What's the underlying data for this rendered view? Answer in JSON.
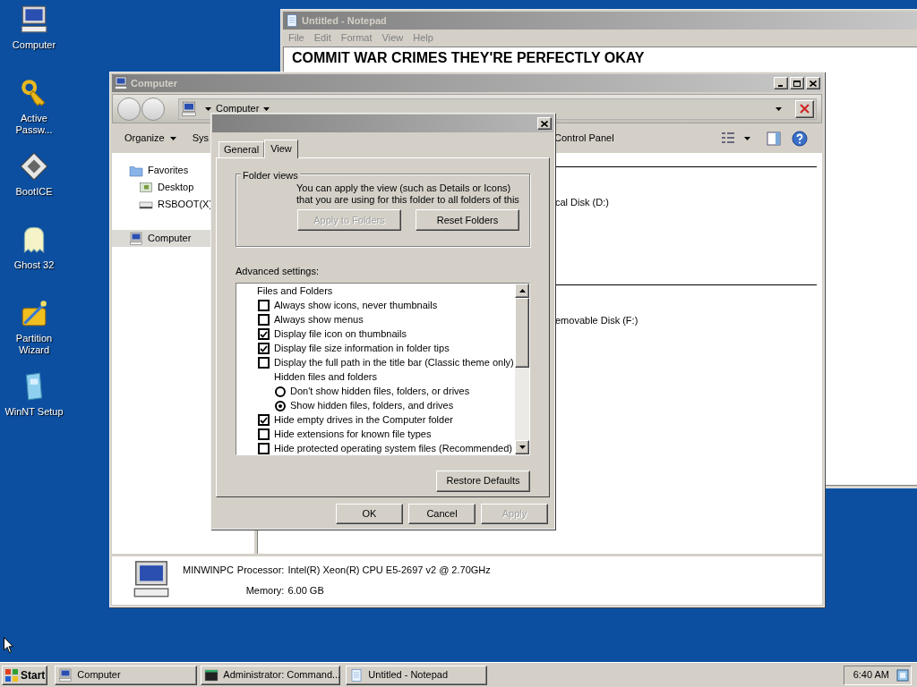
{
  "desktop_icons": [
    {
      "label": "Computer",
      "kind": "computer"
    },
    {
      "label": "Active Passw...",
      "kind": "key"
    },
    {
      "label": "BootICE",
      "kind": "bootice"
    },
    {
      "label": "Ghost 32",
      "kind": "ghost"
    },
    {
      "label": "Partition Wizard",
      "kind": "wizard"
    },
    {
      "label": "WinNT Setup",
      "kind": "setup"
    }
  ],
  "notepad": {
    "title": "Untitled - Notepad",
    "menu": [
      "File",
      "Edit",
      "Format",
      "View",
      "Help"
    ],
    "lines": [
      "COMMIT WAR CRIMES THEY'RE PERFECTLY OKAY"
    ]
  },
  "explorer": {
    "title": "Computer",
    "address": "Computer",
    "organize": "Organize",
    "toolbar_items": [
      "Sys",
      "Control Panel"
    ],
    "nav": [
      {
        "label": "Favorites",
        "kind": "folder",
        "selected": false,
        "children": [
          {
            "label": "Desktop",
            "kind": "desktop",
            "selected": false
          },
          {
            "label": "RSBOOT(X)",
            "kind": "drive",
            "selected": false
          }
        ]
      },
      {
        "label": "Computer",
        "kind": "computer",
        "selected": true
      }
    ],
    "drives": [
      "cal Disk (D:)",
      "emovable Disk (F:)"
    ],
    "details": {
      "computer_name": "MINWINPC",
      "properties": [
        {
          "label": "Processor:",
          "value": "Intel(R) Xeon(R) CPU E5-2697 v2 @ 2.70GHz"
        },
        {
          "label": "Memory:",
          "value": "6.00 GB"
        }
      ]
    }
  },
  "dialog": {
    "tabs": [
      {
        "label": "General",
        "selected": false
      },
      {
        "label": "View",
        "selected": true
      }
    ],
    "group_title": "Folder views",
    "description": "You can apply the view (such as Details or Icons) that you are using for this folder to all folders of this",
    "group_buttons": [
      {
        "label": "Apply to Folders",
        "disabled": true
      },
      {
        "label": "Reset Folders",
        "disabled": false
      }
    ],
    "advanced_label": "Advanced settings:",
    "settings": [
      {
        "kind": "group",
        "label": "Files and Folders",
        "children": [
          {
            "kind": "checkbox",
            "label": "Always show icons, never thumbnails",
            "checked": false
          },
          {
            "kind": "checkbox",
            "label": "Always show menus",
            "checked": false
          },
          {
            "kind": "checkbox",
            "label": "Display file icon on thumbnails",
            "checked": true
          },
          {
            "kind": "checkbox",
            "label": "Display file size information in folder tips",
            "checked": true
          },
          {
            "kind": "checkbox",
            "label": "Display the full path in the title bar (Classic theme only)",
            "checked": false
          },
          {
            "kind": "group",
            "label": "Hidden files and folders",
            "children": [
              {
                "kind": "radio",
                "label": "Don't show hidden files, folders, or drives",
                "checked": false
              },
              {
                "kind": "radio",
                "label": "Show hidden files, folders, and drives",
                "checked": true
              }
            ]
          },
          {
            "kind": "checkbox",
            "label": "Hide empty drives in the Computer folder",
            "checked": true
          },
          {
            "kind": "checkbox",
            "label": "Hide extensions for known file types",
            "checked": false
          },
          {
            "kind": "checkbox",
            "label": "Hide protected operating system files (Recommended)",
            "checked": false
          }
        ]
      }
    ],
    "restore_button": "Restore Defaults",
    "footer_buttons": [
      {
        "label": "OK",
        "disabled": false
      },
      {
        "label": "Cancel",
        "disabled": false
      },
      {
        "label": "Apply",
        "disabled": true
      }
    ]
  },
  "taskbar": {
    "start": "Start",
    "tasks": [
      {
        "label": "Computer",
        "kind": "computer"
      },
      {
        "label": "Administrator: Command...",
        "kind": "cmd"
      },
      {
        "label": "Untitled - Notepad",
        "kind": "notepad"
      }
    ],
    "clock": "6:40 AM"
  }
}
